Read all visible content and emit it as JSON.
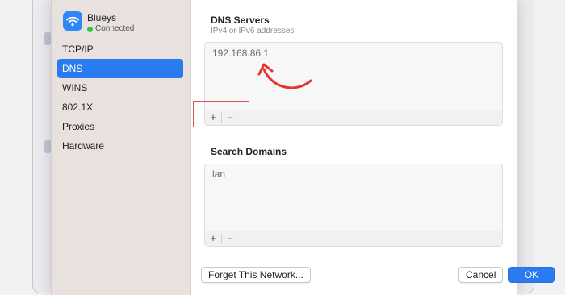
{
  "network": {
    "name": "Blueys",
    "status": "Connected",
    "status_color": "#2fc54a",
    "icon": "wifi-icon"
  },
  "sidebar": {
    "items": [
      {
        "label": "TCP/IP",
        "active": false
      },
      {
        "label": "DNS",
        "active": true
      },
      {
        "label": "WINS",
        "active": false
      },
      {
        "label": "802.1X",
        "active": false
      },
      {
        "label": "Proxies",
        "active": false
      },
      {
        "label": "Hardware",
        "active": false
      }
    ]
  },
  "dns": {
    "title": "DNS Servers",
    "subtitle": "IPv4 or IPv6 addresses",
    "servers": [
      "192.168.86.1"
    ],
    "add_label": "+",
    "remove_label": "−"
  },
  "search": {
    "title": "Search Domains",
    "domains": [
      "lan"
    ],
    "add_label": "+",
    "remove_label": "−"
  },
  "footer": {
    "forget_label": "Forget This Network...",
    "cancel_label": "Cancel",
    "ok_label": "OK"
  },
  "colors": {
    "accent": "#2a7bf0",
    "annotation": "#e5342d"
  }
}
